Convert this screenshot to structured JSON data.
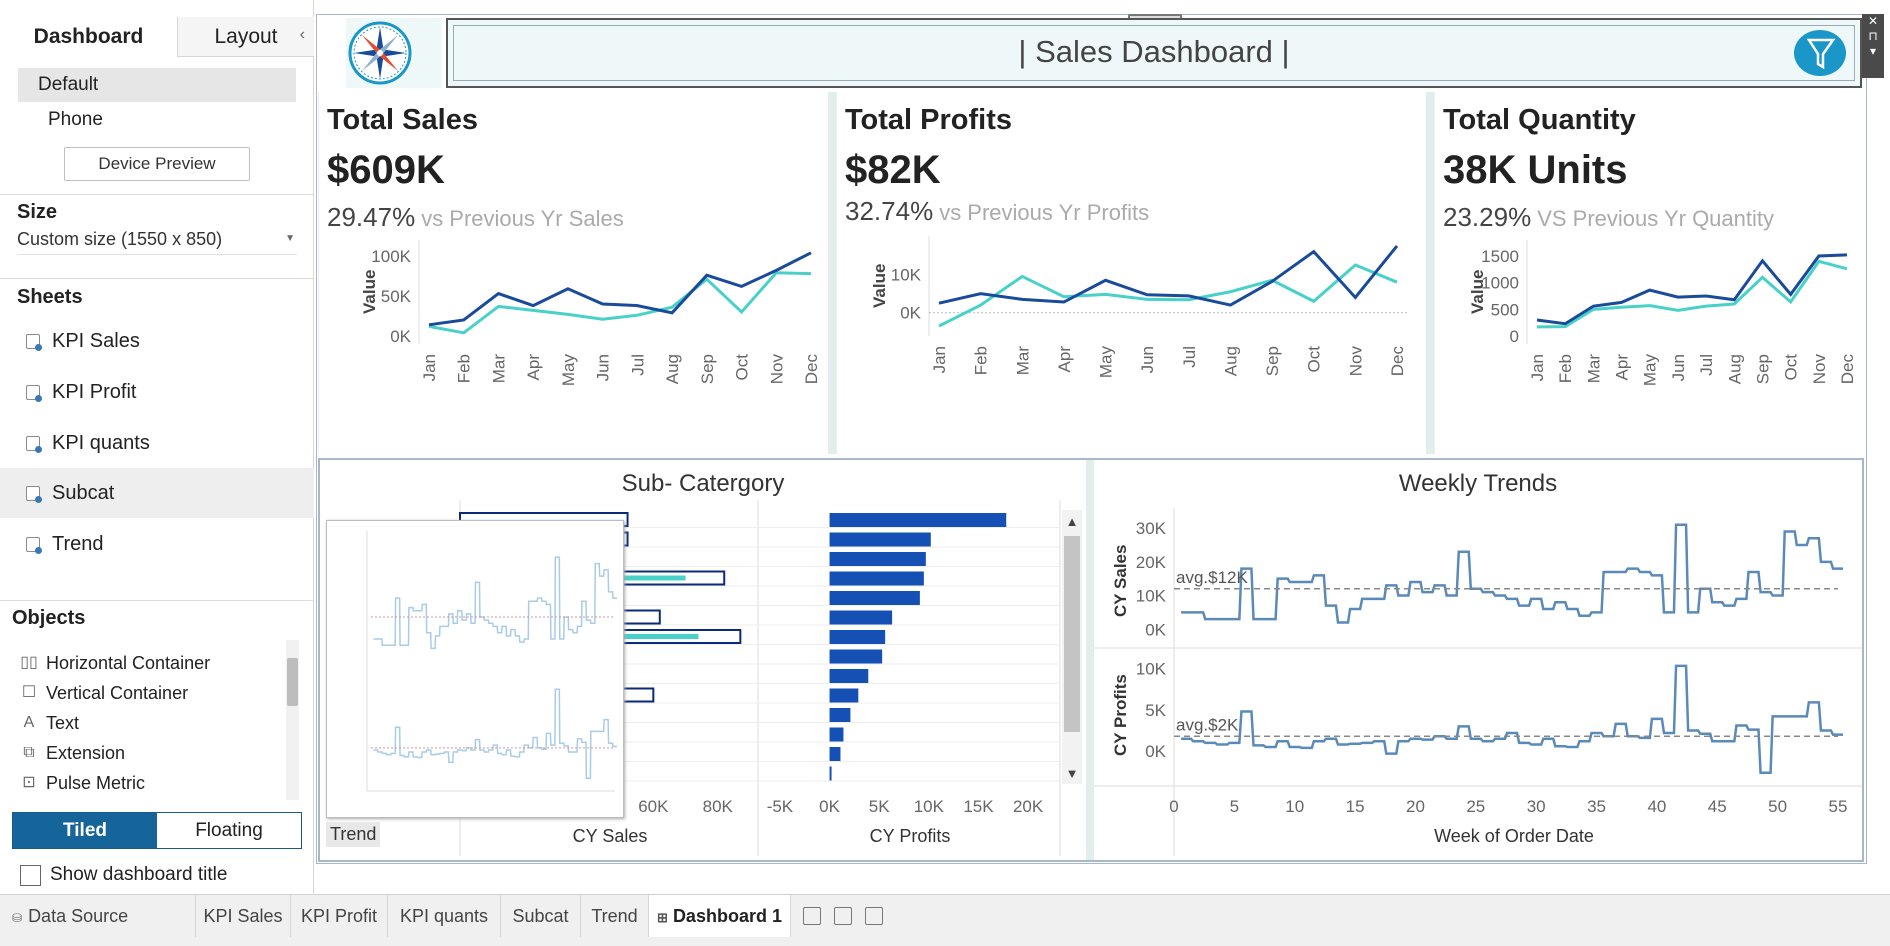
{
  "left_panel": {
    "tabs": [
      "Dashboard",
      "Layout"
    ],
    "device": {
      "default": "Default",
      "phone": "Phone",
      "preview_button": "Device Preview"
    },
    "size": {
      "title": "Size",
      "value": "Custom size (1550 x 850)"
    },
    "sheets_title": "Sheets",
    "sheets": [
      "KPI Sales",
      "KPI Profit",
      "KPI quants",
      "Subcat",
      "Trend"
    ],
    "objects_title": "Objects",
    "objects": [
      "Horizontal Container",
      "Vertical Container",
      "Text",
      "Extension",
      "Pulse Metric"
    ],
    "tiled": "Tiled",
    "floating": "Floating",
    "show_title": "Show dashboard title"
  },
  "dashboard": {
    "title": "| Sales Dashboard |",
    "kpis": [
      {
        "title": "Total Sales",
        "value": "$609K",
        "pct": "29.47%",
        "vs": "vs Previous Yr Sales"
      },
      {
        "title": "Total Profits",
        "value": "$82K",
        "pct": "32.74%",
        "vs": "vs Previous Yr Profits"
      },
      {
        "title": "Total Quantity",
        "value": "38K Units",
        "pct": "23.29%",
        "vs": "VS Previous Yr Quantity"
      }
    ],
    "subcat_title": "Sub- Catergory",
    "weekly_title": "Weekly Trends",
    "tooltip_label": "Trend"
  },
  "colors": {
    "current": "#1a4a9a",
    "previous": "#48d1c8",
    "bar": "#1550b4",
    "accent": "#1a97c8",
    "trend": "#5a8ab8"
  },
  "chart_data": [
    {
      "type": "line",
      "name": "KPI Sales",
      "x": [
        "Jan",
        "Feb",
        "Mar",
        "Apr",
        "May",
        "Jun",
        "Jul",
        "Aug",
        "Sep",
        "Oct",
        "Nov",
        "Dec"
      ],
      "ylabel": "Value",
      "yticks": [
        "0K",
        "50K",
        "100K"
      ],
      "ylim": [
        0,
        110000
      ],
      "series": [
        {
          "values": [
            14000,
            20000,
            53000,
            38000,
            59000,
            40000,
            38000,
            29000,
            76000,
            62000,
            82000,
            104000
          ]
        },
        {
          "values": [
            12000,
            4000,
            37000,
            32000,
            27000,
            21000,
            26000,
            36000,
            71000,
            30000,
            79000,
            78000
          ]
        }
      ]
    },
    {
      "type": "line",
      "name": "KPI Profit",
      "x": [
        "Jan",
        "Feb",
        "Mar",
        "Apr",
        "May",
        "Jun",
        "Jul",
        "Aug",
        "Sep",
        "Oct",
        "Nov",
        "Dec"
      ],
      "ylabel": "Value",
      "yticks": [
        "0K",
        "10K"
      ],
      "ylim": [
        -4000,
        18000
      ],
      "series": [
        {
          "values": [
            2500,
            5000,
            3500,
            2800,
            8500,
            4700,
            4400,
            2000,
            8200,
            16000,
            4000,
            17500
          ]
        },
        {
          "values": [
            -3500,
            2000,
            9500,
            4200,
            4800,
            3500,
            3400,
            5500,
            8500,
            3000,
            12500,
            8000
          ]
        }
      ]
    },
    {
      "type": "line",
      "name": "KPI quants",
      "x": [
        "Jan",
        "Feb",
        "Mar",
        "Apr",
        "May",
        "Jun",
        "Jul",
        "Aug",
        "Sep",
        "Oct",
        "Nov",
        "Dec"
      ],
      "ylabel": "Value",
      "yticks": [
        "0",
        "500",
        "1000",
        "1500"
      ],
      "ylim": [
        0,
        1650
      ],
      "series": [
        {
          "values": [
            300,
            230,
            560,
            630,
            860,
            730,
            750,
            680,
            1410,
            780,
            1500,
            1520
          ]
        },
        {
          "values": [
            170,
            175,
            500,
            540,
            570,
            480,
            560,
            600,
            1100,
            640,
            1400,
            1260
          ]
        }
      ]
    },
    {
      "type": "bar",
      "name": "Sub-category CY Sales",
      "xlabel": "CY Sales",
      "xticks": [
        "60K",
        "80K"
      ],
      "xlim": [
        0,
        90000
      ],
      "values": [
        52000,
        52000,
        0,
        82000,
        0,
        62000,
        87000,
        0,
        0,
        60000,
        0,
        0,
        0,
        0
      ],
      "previous": [
        0,
        0,
        0,
        70000,
        0,
        0,
        74000,
        0,
        0,
        0,
        0,
        0,
        0,
        0
      ]
    },
    {
      "type": "bar",
      "name": "Sub-category CY Profits",
      "xlabel": "CY Profits",
      "xticks": [
        "-5K",
        "0K",
        "5K",
        "10K",
        "15K",
        "20K"
      ],
      "xlim": [
        -6000,
        21000
      ],
      "values": [
        17800,
        10200,
        9700,
        9500,
        9100,
        6300,
        5600,
        5300,
        3900,
        2900,
        2100,
        1400,
        1100,
        200
      ]
    },
    {
      "type": "line",
      "name": "Weekly Trends",
      "xlabel": "Week of Order Date",
      "xticks": [
        "0",
        "5",
        "10",
        "15",
        "20",
        "25",
        "30",
        "35",
        "40",
        "45",
        "50",
        "55"
      ],
      "xlim": [
        0,
        55
      ],
      "series": [
        {
          "name": "CY Sales",
          "avg_label": "avg.$12K",
          "yticks": [
            "0K",
            "10K",
            "20K",
            "30K"
          ],
          "ylim": [
            -2000,
            33000
          ],
          "avg": 12000,
          "values": [
            5000,
            5000,
            3000,
            3000,
            3000,
            18000,
            3000,
            3000,
            15000,
            14000,
            14000,
            16000,
            7000,
            2000,
            6000,
            9000,
            9000,
            13000,
            10000,
            14000,
            11000,
            13000,
            10000,
            23000,
            12000,
            11000,
            10000,
            9000,
            7000,
            9000,
            6000,
            8000,
            6000,
            4000,
            5000,
            17000,
            17000,
            18000,
            17000,
            16000,
            5000,
            31000,
            5000,
            12000,
            8000,
            7000,
            9000,
            17000,
            11000,
            10000,
            29000,
            25000,
            27000,
            20000,
            18000
          ]
        },
        {
          "name": "CY Profits",
          "avg_label": "avg.$2K",
          "yticks": [
            "0K",
            "5K",
            "10K"
          ],
          "ylim": [
            -3000,
            11500
          ],
          "avg": 1800,
          "values": [
            1500,
            1200,
            1000,
            800,
            1000,
            4800,
            700,
            500,
            1200,
            500,
            400,
            1200,
            1500,
            800,
            900,
            1000,
            1200,
            -300,
            1200,
            1500,
            1400,
            1800,
            1500,
            3000,
            1500,
            1200,
            1500,
            2200,
            1000,
            800,
            1500,
            600,
            500,
            1200,
            2200,
            1800,
            3300,
            1800,
            1600,
            3900,
            2200,
            10300,
            2500,
            2100,
            1200,
            1200,
            3100,
            2600,
            -2600,
            4200,
            4200,
            4200,
            5900,
            2500,
            2000
          ]
        }
      ]
    }
  ],
  "bottom_tabs": [
    "Data Source",
    "KPI Sales",
    "KPI Profit",
    "KPI quants",
    "Subcat",
    "Trend",
    "Dashboard 1"
  ]
}
